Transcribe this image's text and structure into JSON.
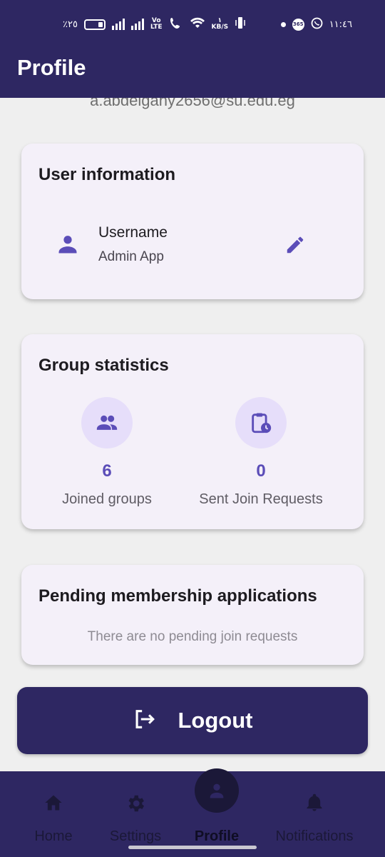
{
  "status_bar": {
    "battery_percent": "٪٢٥",
    "network_label_top": "Vo",
    "network_label_bottom": "LTE",
    "speed_top": "١",
    "speed_bottom": "KB/S",
    "app_badge": "365",
    "time": "١١:٤٦"
  },
  "app_bar": {
    "title": "Profile"
  },
  "profile": {
    "email": "a.abdelgany2656@su.edu.eg"
  },
  "user_info": {
    "title": "User information",
    "username_label": "Username",
    "username_value": "Admin App",
    "icons": {
      "person": "person-icon",
      "edit": "edit-pencil-icon"
    }
  },
  "group_stats": {
    "title": "Group statistics",
    "items": [
      {
        "value": "6",
        "label": "Joined groups",
        "icon": "group-icon"
      },
      {
        "value": "0",
        "label": "Sent Join Requests",
        "icon": "clipboard-clock-icon"
      }
    ]
  },
  "pending": {
    "title": "Pending membership applications",
    "empty_text": "There are no pending join requests"
  },
  "logout": {
    "label": "Logout",
    "icon": "logout-icon"
  },
  "bottom_nav": {
    "items": [
      {
        "label": "Home",
        "icon": "home-icon"
      },
      {
        "label": "Settings",
        "icon": "gear-icon"
      },
      {
        "label": "Profile",
        "icon": "person-icon",
        "active": true
      },
      {
        "label": "Notifications",
        "icon": "bell-icon"
      }
    ]
  },
  "colors": {
    "primary_dark": "#2e2762",
    "accent": "#5b4db8",
    "card_bg": "#f4f0f9",
    "page_bg": "#efefef"
  }
}
